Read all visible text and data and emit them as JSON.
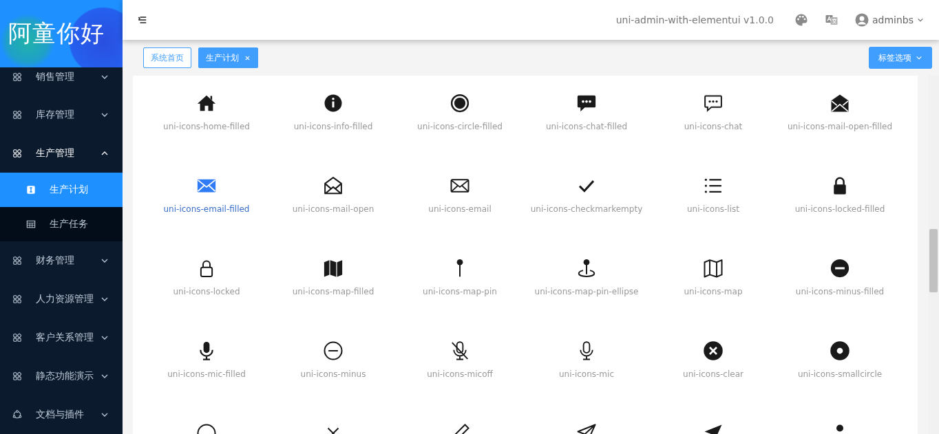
{
  "logo": {
    "text": "阿童你好"
  },
  "sidebar": {
    "items": [
      {
        "label": "销售管理",
        "expanded": false
      },
      {
        "label": "库存管理",
        "expanded": false
      },
      {
        "label": "生产管理",
        "expanded": true,
        "children": [
          {
            "label": "生产计划",
            "selected": true
          },
          {
            "label": "生产任务",
            "selected": false
          }
        ]
      },
      {
        "label": "财务管理",
        "expanded": false
      },
      {
        "label": "人力资源管理",
        "expanded": false
      },
      {
        "label": "客户关系管理",
        "expanded": false
      },
      {
        "label": "静态功能演示",
        "expanded": false
      },
      {
        "label": "文档与插件",
        "expanded": false
      }
    ]
  },
  "header": {
    "title": "uni-admin-with-elementui v1.0.0",
    "user": "adminbs"
  },
  "tags": [
    {
      "label": "系统首页",
      "selected": false
    },
    {
      "label": "生产计划",
      "selected": true
    }
  ],
  "tag_options": {
    "label": "标签选项"
  },
  "icons": [
    {
      "label": "uni-icons-home-filled",
      "selected": false
    },
    {
      "label": "uni-icons-info-filled",
      "selected": false
    },
    {
      "label": "uni-icons-circle-filled",
      "selected": false
    },
    {
      "label": "uni-icons-chat-filled",
      "selected": false
    },
    {
      "label": "uni-icons-chat",
      "selected": false
    },
    {
      "label": "uni-icons-mail-open-filled",
      "selected": false
    },
    {
      "label": "uni-icons-email-filled",
      "selected": true
    },
    {
      "label": "uni-icons-mail-open",
      "selected": false
    },
    {
      "label": "uni-icons-email",
      "selected": false
    },
    {
      "label": "uni-icons-checkmarkempty",
      "selected": false
    },
    {
      "label": "uni-icons-list",
      "selected": false
    },
    {
      "label": "uni-icons-locked-filled",
      "selected": false
    },
    {
      "label": "uni-icons-locked",
      "selected": false
    },
    {
      "label": "uni-icons-map-filled",
      "selected": false
    },
    {
      "label": "uni-icons-map-pin",
      "selected": false
    },
    {
      "label": "uni-icons-map-pin-ellipse",
      "selected": false
    },
    {
      "label": "uni-icons-map",
      "selected": false
    },
    {
      "label": "uni-icons-minus-filled",
      "selected": false
    },
    {
      "label": "uni-icons-mic-filled",
      "selected": false
    },
    {
      "label": "uni-icons-minus",
      "selected": false
    },
    {
      "label": "uni-icons-micoff",
      "selected": false
    },
    {
      "label": "uni-icons-mic",
      "selected": false
    },
    {
      "label": "uni-icons-clear",
      "selected": false
    },
    {
      "label": "uni-icons-smallcircle",
      "selected": false
    }
  ]
}
